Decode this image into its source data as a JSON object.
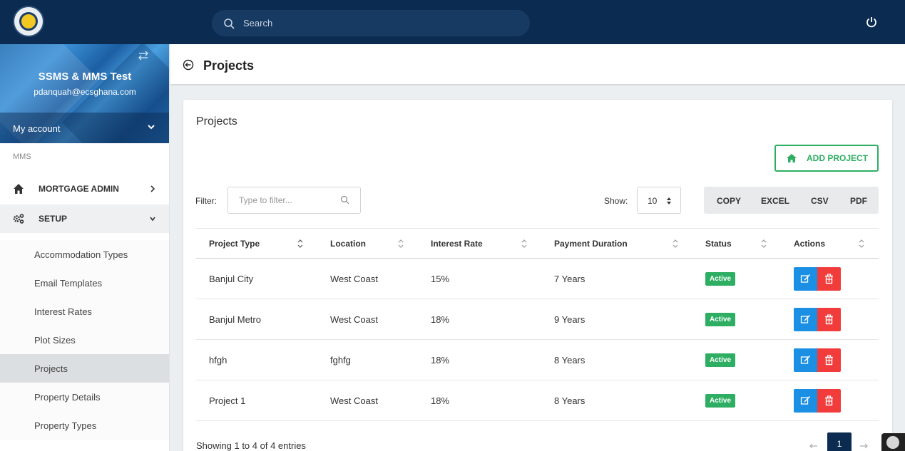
{
  "topbar": {
    "search_placeholder": "Search",
    "logo_icon": "seal-logo",
    "power_icon": "power-icon",
    "bg_color": "#0c2b50"
  },
  "sidebar": {
    "profile_name": "SSMS & MMS Test",
    "profile_email": "pdanquah@ecsghana.com",
    "my_account": "My account",
    "section": "MMS",
    "nav": [
      {
        "label": "MORTGAGE ADMIN",
        "icon": "home-icon"
      },
      {
        "label": "SETUP",
        "icon": "gears-icon"
      }
    ],
    "setup_items": [
      {
        "label": "Accommodation Types"
      },
      {
        "label": "Email Templates"
      },
      {
        "label": "Interest Rates"
      },
      {
        "label": "Plot Sizes"
      },
      {
        "label": "Projects",
        "active": true
      },
      {
        "label": "Property Details"
      },
      {
        "label": "Property Types"
      }
    ]
  },
  "header": {
    "title": "Projects"
  },
  "card": {
    "title": "Projects",
    "add_button": "ADD PROJECT",
    "filter_label": "Filter:",
    "filter_placeholder": "Type to filter...",
    "show_label": "Show:",
    "show_value": "10",
    "export_buttons": [
      "COPY",
      "EXCEL",
      "CSV",
      "PDF"
    ],
    "columns": [
      "Project Type",
      "Location",
      "Interest Rate",
      "Payment Duration",
      "Status",
      "Actions"
    ],
    "rows": [
      {
        "type": "Banjul City",
        "location": "West Coast",
        "rate": "15%",
        "duration": "7 Years",
        "status": "Active"
      },
      {
        "type": "Banjul Metro",
        "location": "West Coast",
        "rate": "18%",
        "duration": "9 Years",
        "status": "Active"
      },
      {
        "type": "hfgh",
        "location": "fghfg",
        "rate": "18%",
        "duration": "8 Years",
        "status": "Active"
      },
      {
        "type": "Project 1",
        "location": "West Coast",
        "rate": "18%",
        "duration": "8 Years",
        "status": "Active"
      }
    ],
    "showing": "Showing 1 to 4 of 4 entries",
    "current_page": "1"
  },
  "colors": {
    "accent_green": "#2dae62",
    "edit_blue": "#1a8fe3",
    "delete_red": "#f23b3b"
  }
}
